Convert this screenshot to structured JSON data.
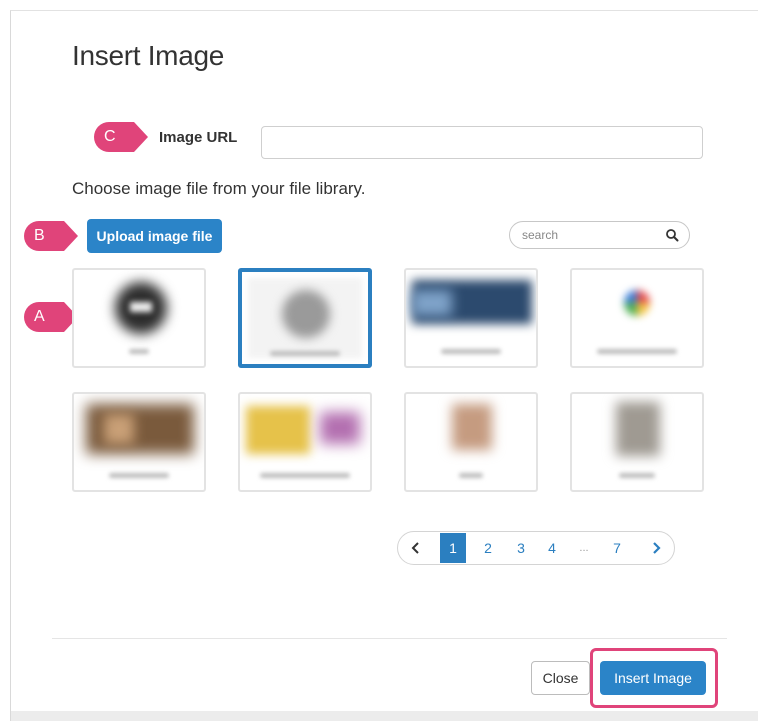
{
  "dialog": {
    "title": "Insert Image",
    "choose_text": "Choose image file from your file library."
  },
  "markers": {
    "a": "A",
    "b": "B",
    "c": "C"
  },
  "url": {
    "label": "Image URL",
    "value": "",
    "placeholder": ""
  },
  "upload": {
    "label": "Upload image file"
  },
  "search": {
    "placeholder": "search",
    "icon": "search-icon"
  },
  "thumbnails": {
    "count": 8,
    "selected_index": 1
  },
  "pagination": {
    "prev_icon": "chevron-left-icon",
    "pages": [
      "1",
      "2",
      "3",
      "4",
      "...",
      "7"
    ],
    "current": "1",
    "next_icon": "chevron-right-icon"
  },
  "footer": {
    "close_label": "Close",
    "insert_label": "Insert Image"
  },
  "colors": {
    "primary": "#2b84c8",
    "highlight": "#e0447a"
  }
}
